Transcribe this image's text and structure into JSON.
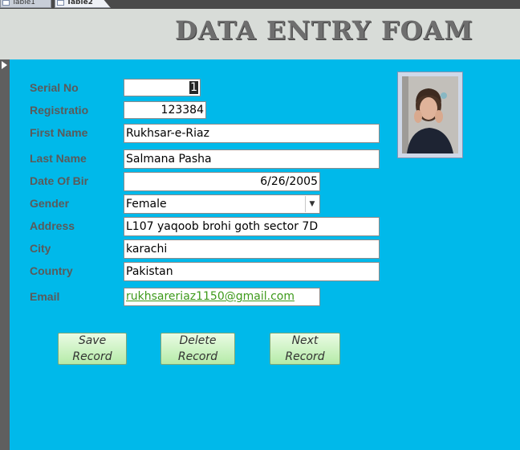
{
  "tabs": [
    {
      "label": "Table1"
    },
    {
      "label": "Table2"
    }
  ],
  "header": {
    "title": "DATA ENTRY FOAM"
  },
  "form": {
    "serial_label": "Serial No",
    "serial_value": "1",
    "registration_label": "Registratio",
    "registration_value": "123384",
    "first_name_label": "First Name",
    "first_name_value": "Rukhsar-e-Riaz",
    "last_name_label": "Last Name",
    "last_name_value": "Salmana Pasha",
    "dob_label": "Date Of Bir",
    "dob_value": "6/26/2005",
    "gender_label": "Gender",
    "gender_value": "Female",
    "address_label": "Address",
    "address_value": "L107 yaqoob brohi goth sector 7D",
    "city_label": "City",
    "city_value": "karachi",
    "country_label": "Country",
    "country_value": "Pakistan",
    "email_label": "Email",
    "email_value": "rukhsareriaz1150@gmail.com"
  },
  "buttons": {
    "save": "Save Record",
    "delete_line1": "Delete",
    "delete_line2": "Record",
    "next": "Next Record"
  },
  "colors": {
    "form_bg": "#00b9ea",
    "header_bg": "#d8dcd8",
    "link": "#3d9a1a"
  }
}
